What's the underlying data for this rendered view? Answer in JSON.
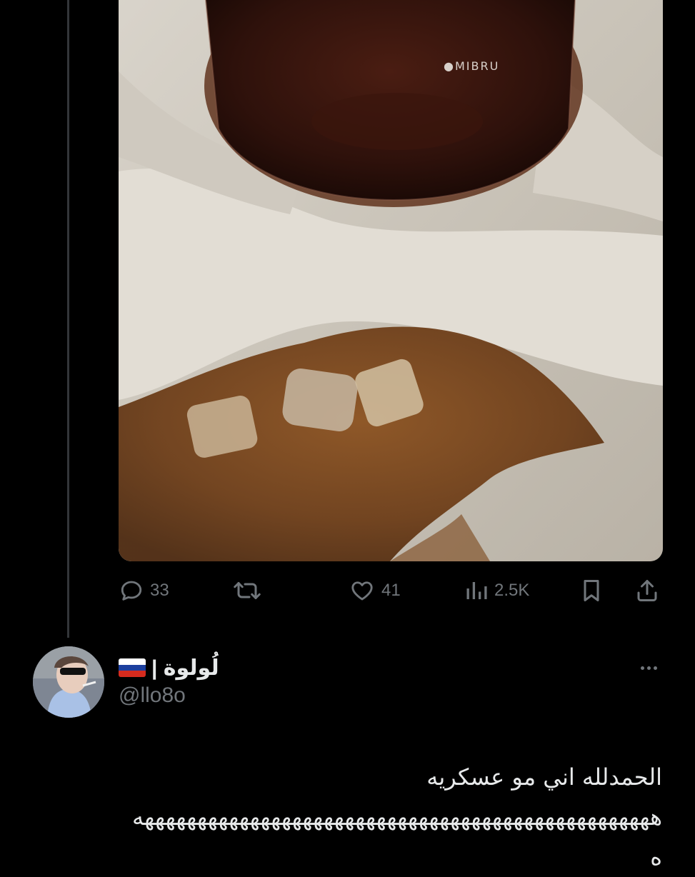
{
  "post": {
    "media": {
      "watermark": "●MIBRU"
    },
    "actions": {
      "replies": "33",
      "likes": "41",
      "views": "2.5K"
    }
  },
  "reply": {
    "display_name": "لُولوة |",
    "flag": "russia-flag",
    "handle": "@llo8o",
    "text_line1": "الحمدلله اني مو عسكريه",
    "text_line2": "هههههههههههههههههههههههههههههههههههههههههههههههههه",
    "text_line3": "ه"
  },
  "colors": {
    "background": "#000000",
    "text_primary": "#e7e9ea",
    "text_secondary": "#71767b",
    "thread_line": "#333639"
  }
}
